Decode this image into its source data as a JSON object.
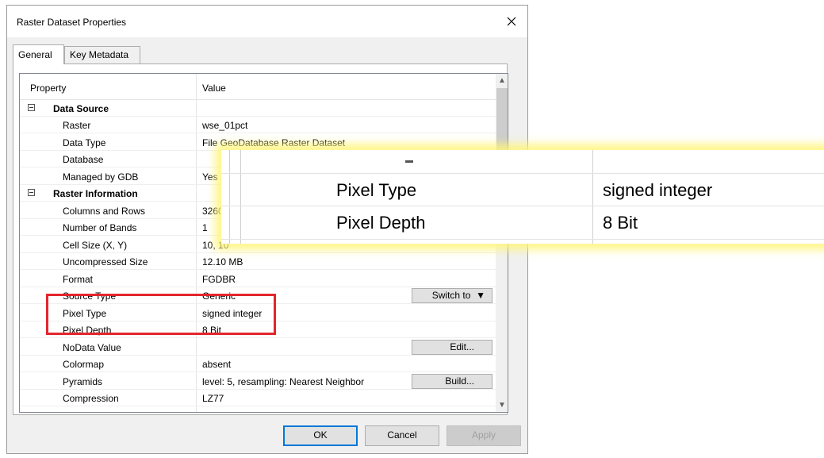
{
  "window": {
    "title": "Raster Dataset Properties"
  },
  "tabs": [
    {
      "label": "General"
    },
    {
      "label": "Key Metadata"
    }
  ],
  "grid": {
    "headers": {
      "property": "Property",
      "value": "Value"
    },
    "rows": [
      {
        "key": "Data Source",
        "value": ""
      },
      {
        "key": "Raster",
        "value": "wse_01pct"
      },
      {
        "key": "Data Type",
        "value": "File GeoDatabase Raster Dataset"
      },
      {
        "key": "Database",
        "value": ""
      },
      {
        "key": "Managed by GDB",
        "value": "Yes"
      },
      {
        "key": "Raster Information",
        "value": ""
      },
      {
        "key": "Columns and Rows",
        "value": "3260,"
      },
      {
        "key": "Number of Bands",
        "value": "1"
      },
      {
        "key": "Cell Size (X, Y)",
        "value": "10, 10"
      },
      {
        "key": "Uncompressed Size",
        "value": "12.10 MB"
      },
      {
        "key": "Format",
        "value": "FGDBR"
      },
      {
        "key": "Source Type",
        "value": "Generic"
      },
      {
        "key": "Pixel Type",
        "value": "signed integer"
      },
      {
        "key": "Pixel Depth",
        "value": "8 Bit"
      },
      {
        "key": "NoData Value",
        "value": ""
      },
      {
        "key": "Colormap",
        "value": "absent"
      },
      {
        "key": "Pyramids",
        "value": "level: 5, resampling: Nearest Neighbor"
      },
      {
        "key": "Compression",
        "value": "LZ77"
      }
    ],
    "row_buttons": {
      "switch_to": "Switch to",
      "edit": "Edit...",
      "build": "Build..."
    }
  },
  "zoom_callout": {
    "rows": [
      {
        "key": "Pixel Type",
        "value": "signed integer"
      },
      {
        "key": "Pixel Depth",
        "value": "8 Bit"
      }
    ]
  },
  "buttons": {
    "ok": "OK",
    "cancel": "Cancel",
    "apply": "Apply"
  },
  "colors": {
    "highlight_box": "#e3262e",
    "callout_glow": "#fff478",
    "ok_border": "#0078d7"
  }
}
